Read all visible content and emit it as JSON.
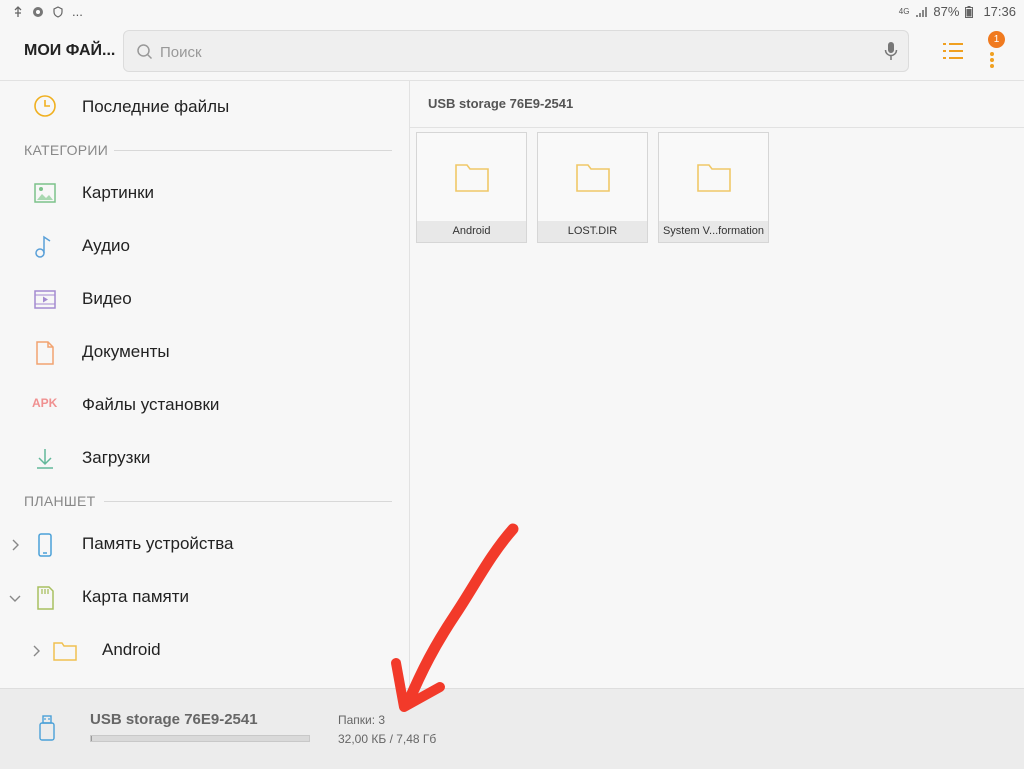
{
  "status_bar": {
    "battery": "87%",
    "time": "17:36",
    "network": "4G",
    "notif_more": "..."
  },
  "app": {
    "title": "МОИ ФАЙ..."
  },
  "search": {
    "placeholder": "Поиск",
    "value": ""
  },
  "notification_badge": "1",
  "sidebar": {
    "recent": "Последние файлы",
    "categories_header": "КАТЕГОРИИ",
    "categories": [
      {
        "label": "Картинки",
        "icon": "image-icon"
      },
      {
        "label": "Аудио",
        "icon": "music-note-icon"
      },
      {
        "label": "Видео",
        "icon": "video-icon"
      },
      {
        "label": "Документы",
        "icon": "document-icon"
      },
      {
        "label": "Файлы установки",
        "icon": "apk-icon",
        "icon_text": "APK"
      },
      {
        "label": "Загрузки",
        "icon": "download-icon"
      }
    ],
    "tablet_header": "ПЛАНШЕТ",
    "tablet": [
      {
        "label": "Память устройства",
        "icon": "phone-icon",
        "expanded": false
      },
      {
        "label": "Карта памяти",
        "icon": "sd-card-icon",
        "expanded": true
      }
    ],
    "subfolder": {
      "label": "Android"
    }
  },
  "content": {
    "breadcrumb": "USB storage 76E9-2541",
    "folders": [
      {
        "name": "Android"
      },
      {
        "name": "LOST.DIR"
      },
      {
        "name": "System V...formation"
      }
    ]
  },
  "storage": {
    "name": "USB storage 76E9-2541",
    "folders_label": "Папки: 3",
    "usage": "32,00 КБ / 7,48 Гб",
    "used_fraction": 0.004
  },
  "colors": {
    "accent": "#f0a020",
    "badge": "#f07a1f",
    "folder": "#f5d58a",
    "annotation": "#f23a2a"
  }
}
